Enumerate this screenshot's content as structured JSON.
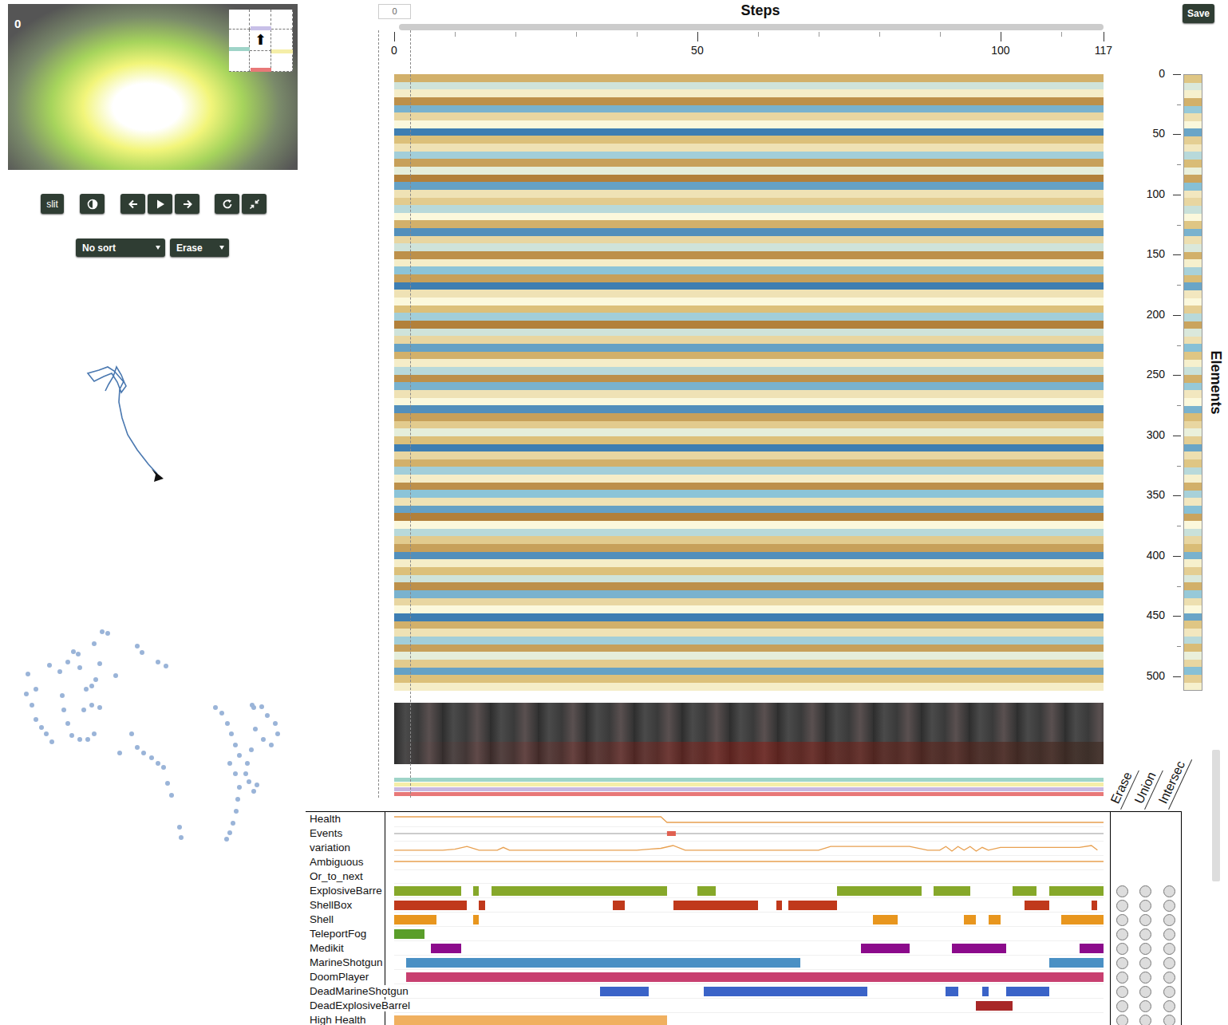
{
  "game_view": {
    "step": "0",
    "minimap_arrow": "⬆"
  },
  "controls": {
    "slit_label": "slit"
  },
  "dropdowns": [
    {
      "value": "No sort"
    },
    {
      "value": "Erase"
    }
  ],
  "save": "Save",
  "steps_axis": {
    "title": "Steps",
    "input": "0",
    "ticks": [
      "0",
      "50",
      "100",
      "117"
    ]
  },
  "elements_axis": {
    "title": "Elements",
    "max": 512,
    "ticks": [
      "0",
      "50",
      "100",
      "150",
      "200",
      "250",
      "300",
      "350",
      "400",
      "450",
      "500"
    ]
  },
  "heatmap": {
    "rows": [
      0.6,
      -0.2,
      0.1,
      0.8,
      -0.6,
      0.3,
      0.0,
      -0.9,
      0.5,
      0.2,
      -0.4,
      0.7,
      -0.1,
      0.9,
      -0.7,
      0.2,
      0.4,
      -0.3,
      0.0,
      0.6,
      -0.8,
      0.3,
      -0.2,
      0.8,
      0.1,
      -0.5,
      0.7,
      -0.9,
      0.2,
      0.0,
      0.5,
      -0.4,
      0.9,
      -0.2,
      0.3,
      -0.7,
      0.6,
      0.1,
      -0.3,
      0.8,
      -0.6,
      0.2,
      0.0,
      -0.8,
      0.7,
      0.4,
      -0.1,
      0.5,
      -0.9,
      0.3,
      0.6,
      -0.4,
      0.1,
      0.8,
      -0.5,
      0.2,
      -0.7,
      0.9,
      0.0,
      -0.3,
      0.4,
      0.7,
      -0.8,
      0.1,
      0.5,
      -0.2,
      0.8,
      -0.6,
      0.3,
      0.0,
      -0.9,
      0.6,
      0.2,
      -0.4,
      0.7,
      -0.1,
      0.4,
      -0.7,
      0.5,
      0.1
    ]
  },
  "action_strips": [
    {
      "color": "#9fd4c8"
    },
    {
      "color": "#f5eea8"
    },
    {
      "color": "#c8b8e0"
    },
    {
      "color": "#e87878"
    }
  ],
  "toggle_headers": [
    "Erase",
    "Union",
    "Intersec"
  ],
  "series": [
    {
      "label": "Health",
      "kind": "line",
      "steps": [
        0,
        44,
        45,
        117
      ],
      "values": [
        100,
        100,
        88,
        88
      ]
    },
    {
      "label": "Events",
      "kind": "events",
      "marks": [
        45
      ]
    },
    {
      "label": "variation",
      "kind": "line",
      "steps": [
        0,
        8,
        10,
        12,
        14,
        17,
        18,
        19,
        22,
        30,
        40,
        42,
        44,
        46,
        48,
        55,
        65,
        70,
        72,
        75,
        80,
        82,
        85,
        88,
        90,
        91,
        92,
        93,
        94,
        95,
        96,
        97,
        98,
        100,
        105,
        110,
        113,
        115,
        116
      ],
      "values": [
        0.2,
        0.2,
        0.3,
        0.6,
        0.2,
        0.2,
        0.5,
        0.2,
        0.2,
        0.2,
        0.2,
        0.3,
        0.4,
        0.7,
        0.2,
        0.2,
        0.2,
        0.2,
        0.6,
        0.6,
        0.6,
        0.6,
        0.6,
        0.2,
        0.2,
        0.6,
        0.1,
        0.6,
        0.2,
        0.6,
        0.1,
        0.5,
        0.2,
        0.5,
        0.5,
        0.5,
        0.5,
        0.7,
        0.2
      ]
    },
    {
      "label": "Ambiguous",
      "kind": "line",
      "steps": [
        0,
        117
      ],
      "values": [
        0,
        0
      ]
    },
    {
      "label": "Or_to_next",
      "kind": "empty"
    }
  ],
  "categories": [
    {
      "label": "ExplosiveBarre",
      "color": "#86a82a",
      "segments": [
        [
          0,
          11
        ],
        [
          13,
          14
        ],
        [
          16,
          45
        ],
        [
          50,
          53
        ],
        [
          73,
          87
        ],
        [
          89,
          95
        ],
        [
          102,
          106
        ],
        [
          108,
          117
        ]
      ],
      "erase": false,
      "union": false,
      "intersect": false
    },
    {
      "label": "ShellBox",
      "color": "#c0391b",
      "segments": [
        [
          0,
          12
        ],
        [
          14,
          15
        ],
        [
          36,
          38
        ],
        [
          46,
          60
        ],
        [
          63,
          64
        ],
        [
          65,
          73
        ],
        [
          104,
          108
        ],
        [
          115,
          116
        ]
      ],
      "erase": false,
      "union": false,
      "intersect": false
    },
    {
      "label": "Shell",
      "color": "#e8961e",
      "segments": [
        [
          0,
          7
        ],
        [
          13,
          14
        ],
        [
          79,
          83
        ],
        [
          94,
          96
        ],
        [
          98,
          100
        ],
        [
          110,
          117
        ]
      ],
      "erase": false,
      "union": false,
      "intersect": false
    },
    {
      "label": "TeleportFog",
      "color": "#5a9e2a",
      "segments": [
        [
          0,
          5
        ]
      ],
      "erase": false,
      "union": false,
      "intersect": false
    },
    {
      "label": "Medikit",
      "color": "#8b0a8b",
      "segments": [
        [
          6,
          11
        ],
        [
          77,
          85
        ],
        [
          92,
          101
        ],
        [
          113,
          117
        ]
      ],
      "erase": false,
      "union": false,
      "intersect": false
    },
    {
      "label": "MarineShotgun",
      "color": "#4a90c4",
      "segments": [
        [
          2,
          67
        ],
        [
          108,
          117
        ]
      ],
      "erase": false,
      "union": false,
      "intersect": false
    },
    {
      "label": "DoomPlayer",
      "color": "#c84070",
      "segments": [
        [
          2,
          117
        ]
      ],
      "erase": false,
      "union": false,
      "intersect": false
    },
    {
      "label": "DeadMarineShotgun",
      "color": "#3a63c8",
      "segments": [
        [
          34,
          42
        ],
        [
          51,
          78
        ],
        [
          91,
          93
        ],
        [
          97,
          98
        ],
        [
          101,
          108
        ]
      ],
      "erase": false,
      "union": false,
      "intersect": false
    },
    {
      "label": "DeadExplosiveBarrel",
      "color": "#a82828",
      "segments": [
        [
          96,
          102
        ]
      ],
      "erase": false,
      "union": false,
      "intersect": false
    },
    {
      "label": "High Health",
      "color": "#f0b060",
      "segments": [
        [
          0,
          45
        ]
      ],
      "erase": false,
      "union": false,
      "intersect": false
    }
  ],
  "trajectory": {
    "points": [
      [
        197,
        592
      ],
      [
        186,
        580
      ],
      [
        172,
        562
      ],
      [
        160,
        543
      ],
      [
        153,
        522
      ],
      [
        149,
        502
      ],
      [
        150,
        486
      ],
      [
        155,
        476
      ],
      [
        158,
        482
      ],
      [
        152,
        490
      ],
      [
        147,
        477
      ],
      [
        140,
        466
      ],
      [
        130,
        470
      ],
      [
        118,
        476
      ],
      [
        110,
        466
      ],
      [
        124,
        462
      ],
      [
        135,
        458
      ],
      [
        143,
        463
      ],
      [
        150,
        471
      ],
      [
        156,
        478
      ],
      [
        152,
        468
      ],
      [
        146,
        458
      ],
      [
        142,
        470
      ],
      [
        136,
        480
      ],
      [
        132,
        488
      ]
    ]
  },
  "projection": {
    "points": [
      [
        35,
        843
      ],
      [
        45,
        862
      ],
      [
        33,
        868
      ],
      [
        40,
        882
      ],
      [
        45,
        900
      ],
      [
        52,
        910
      ],
      [
        58,
        918
      ],
      [
        65,
        928
      ],
      [
        62,
        832
      ],
      [
        75,
        840
      ],
      [
        85,
        828
      ],
      [
        92,
        815
      ],
      [
        98,
        818
      ],
      [
        100,
        835
      ],
      [
        118,
        805
      ],
      [
        128,
        790
      ],
      [
        135,
        792
      ],
      [
        125,
        830
      ],
      [
        120,
        850
      ],
      [
        115,
        858
      ],
      [
        108,
        862
      ],
      [
        78,
        870
      ],
      [
        80,
        888
      ],
      [
        85,
        905
      ],
      [
        90,
        920
      ],
      [
        100,
        925
      ],
      [
        110,
        925
      ],
      [
        118,
        918
      ],
      [
        105,
        888
      ],
      [
        115,
        882
      ],
      [
        125,
        885
      ],
      [
        145,
        845
      ],
      [
        172,
        808
      ],
      [
        178,
        816
      ],
      [
        198,
        828
      ],
      [
        208,
        833
      ],
      [
        165,
        918
      ],
      [
        172,
        935
      ],
      [
        180,
        942
      ],
      [
        190,
        948
      ],
      [
        198,
        955
      ],
      [
        205,
        960
      ],
      [
        210,
        980
      ],
      [
        215,
        995
      ],
      [
        225,
        1035
      ],
      [
        227,
        1048
      ],
      [
        150,
        942
      ],
      [
        270,
        885
      ],
      [
        278,
        892
      ],
      [
        285,
        905
      ],
      [
        290,
        918
      ],
      [
        295,
        932
      ],
      [
        300,
        945
      ],
      [
        288,
        955
      ],
      [
        295,
        968
      ],
      [
        300,
        985
      ],
      [
        298,
        1000
      ],
      [
        296,
        1015
      ],
      [
        292,
        1030
      ],
      [
        288,
        1042
      ],
      [
        284,
        1050
      ],
      [
        318,
        885
      ],
      [
        328,
        884
      ],
      [
        335,
        895
      ],
      [
        345,
        905
      ],
      [
        348,
        918
      ],
      [
        340,
        932
      ],
      [
        330,
        925
      ],
      [
        320,
        912
      ],
      [
        315,
        938
      ],
      [
        310,
        955
      ],
      [
        308,
        968
      ],
      [
        312,
        978
      ],
      [
        318,
        990
      ],
      [
        322,
        982
      ],
      [
        316,
        882
      ]
    ]
  }
}
